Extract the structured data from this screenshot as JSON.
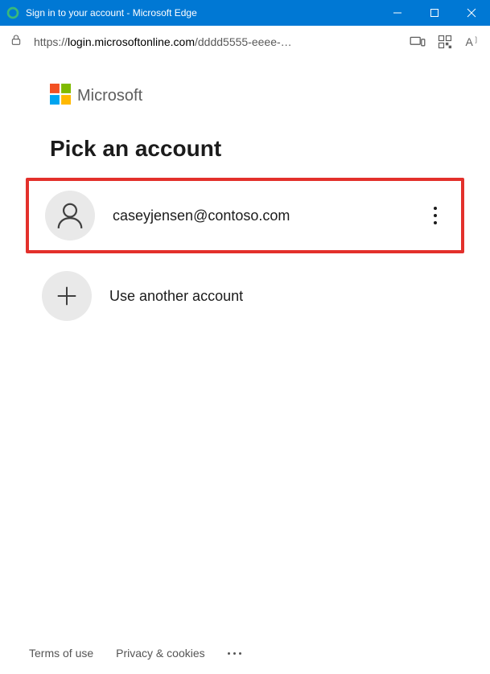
{
  "window": {
    "title": "Sign in to your account - Microsoft Edge"
  },
  "address": {
    "scheme": "https://",
    "domain": "login.microsoftonline.com",
    "path": "/dddd5555-eeee-…"
  },
  "brand": {
    "name": "Microsoft"
  },
  "page": {
    "heading": "Pick an account"
  },
  "accounts": [
    {
      "email": "caseyjensen@contoso.com",
      "highlighted": true
    }
  ],
  "use_another": {
    "label": "Use another account"
  },
  "footer": {
    "terms": "Terms of use",
    "privacy": "Privacy & cookies"
  }
}
